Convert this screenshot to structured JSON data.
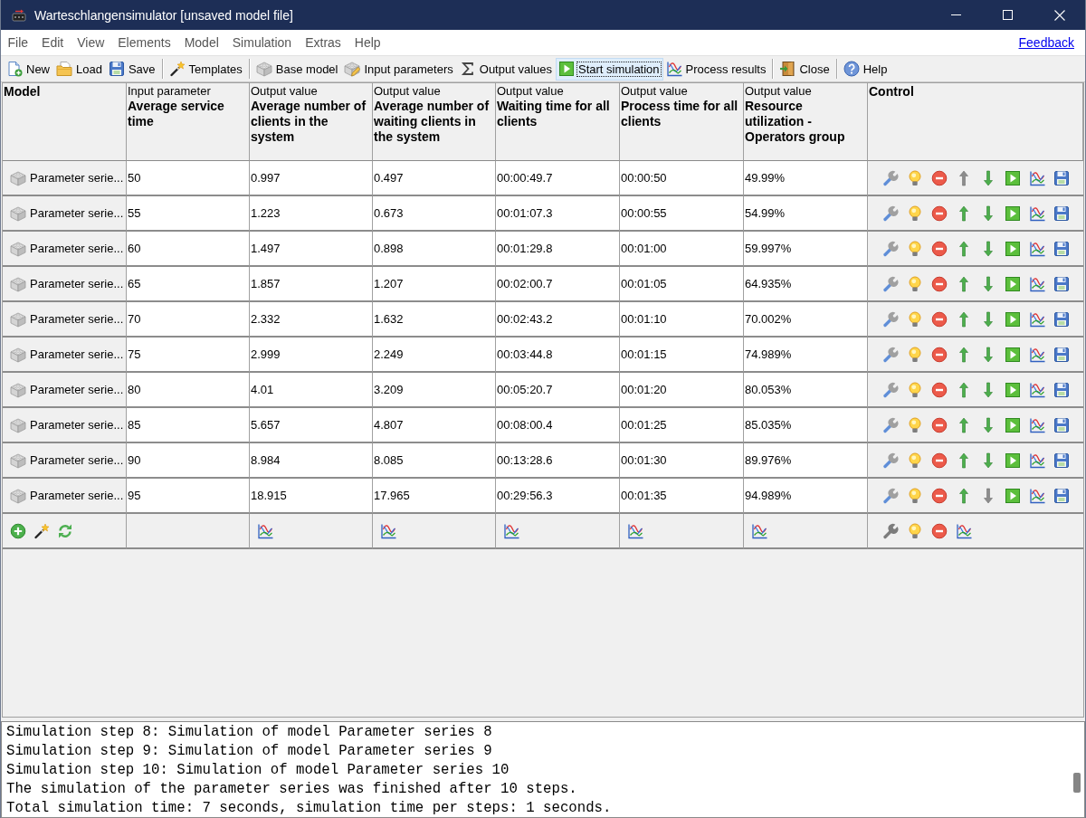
{
  "window": {
    "title": "Warteschlangensimulator [unsaved model file]"
  },
  "menu_bar": {
    "items": [
      "File",
      "Edit",
      "View",
      "Elements",
      "Model",
      "Simulation",
      "Extras",
      "Help"
    ],
    "link": "Feedback"
  },
  "toolbar": [
    {
      "kind": "new",
      "label": "New",
      "focused": false,
      "separator_after": false
    },
    {
      "kind": "load",
      "label": "Load",
      "focused": false,
      "separator_after": false
    },
    {
      "kind": "save",
      "label": "Save",
      "focused": false,
      "separator_after": true
    },
    {
      "kind": "templates",
      "label": "Templates",
      "focused": false,
      "separator_after": true
    },
    {
      "kind": "base",
      "label": "Base model",
      "focused": false,
      "separator_after": false
    },
    {
      "kind": "input",
      "label": "Input parameters",
      "focused": false,
      "separator_after": false
    },
    {
      "kind": "output",
      "label": "Output values",
      "focused": false,
      "separator_after": false
    },
    {
      "kind": "start",
      "label": "Start simulation",
      "focused": true,
      "separator_after": false
    },
    {
      "kind": "results",
      "label": "Process results",
      "focused": false,
      "separator_after": true
    },
    {
      "kind": "close",
      "label": "Close",
      "focused": false,
      "separator_after": true
    },
    {
      "kind": "help",
      "label": "Help",
      "focused": false,
      "separator_after": false
    }
  ],
  "table": {
    "columns": [
      {
        "kind": "model",
        "title": "Model"
      },
      {
        "kind": "input",
        "caption": "Input parameter",
        "title": "Average service time"
      },
      {
        "kind": "output",
        "caption": "Output value",
        "title": "Average number of clients in the system"
      },
      {
        "kind": "output",
        "caption": "Output value",
        "title": "Average number of waiting clients in the system"
      },
      {
        "kind": "output",
        "caption": "Output value",
        "title": "Waiting time for all clients"
      },
      {
        "kind": "output",
        "caption": "Output value",
        "title": "Process time for all clients"
      },
      {
        "kind": "output",
        "caption": "Output value",
        "title": "Resource utilization - Operators group"
      },
      {
        "kind": "control",
        "title": "Control"
      }
    ],
    "rows": [
      {
        "model": "Parameter serie...",
        "values": [
          "50",
          "0.997",
          "0.497",
          "00:00:49.7",
          "00:00:50",
          "49.99%"
        ],
        "can_move_up": false,
        "can_move_down": true
      },
      {
        "model": "Parameter serie...",
        "values": [
          "55",
          "1.223",
          "0.673",
          "00:01:07.3",
          "00:00:55",
          "54.99%"
        ],
        "can_move_up": true,
        "can_move_down": true
      },
      {
        "model": "Parameter serie...",
        "values": [
          "60",
          "1.497",
          "0.898",
          "00:01:29.8",
          "00:01:00",
          "59.997%"
        ],
        "can_move_up": true,
        "can_move_down": true
      },
      {
        "model": "Parameter serie...",
        "values": [
          "65",
          "1.857",
          "1.207",
          "00:02:00.7",
          "00:01:05",
          "64.935%"
        ],
        "can_move_up": true,
        "can_move_down": true
      },
      {
        "model": "Parameter serie...",
        "values": [
          "70",
          "2.332",
          "1.632",
          "00:02:43.2",
          "00:01:10",
          "70.002%"
        ],
        "can_move_up": true,
        "can_move_down": true
      },
      {
        "model": "Parameter serie...",
        "values": [
          "75",
          "2.999",
          "2.249",
          "00:03:44.8",
          "00:01:15",
          "74.989%"
        ],
        "can_move_up": true,
        "can_move_down": true
      },
      {
        "model": "Parameter serie...",
        "values": [
          "80",
          "4.01",
          "3.209",
          "00:05:20.7",
          "00:01:20",
          "80.053%"
        ],
        "can_move_up": true,
        "can_move_down": true
      },
      {
        "model": "Parameter serie...",
        "values": [
          "85",
          "5.657",
          "4.807",
          "00:08:00.4",
          "00:01:25",
          "85.035%"
        ],
        "can_move_up": true,
        "can_move_down": true
      },
      {
        "model": "Parameter serie...",
        "values": [
          "90",
          "8.984",
          "8.085",
          "00:13:28.6",
          "00:01:30",
          "89.976%"
        ],
        "can_move_up": true,
        "can_move_down": true
      },
      {
        "model": "Parameter serie...",
        "values": [
          "95",
          "18.915",
          "17.965",
          "00:29:56.3",
          "00:01:35",
          "94.989%"
        ],
        "can_move_up": true,
        "can_move_down": false
      }
    ],
    "footer": {
      "edit_enabled": false
    }
  },
  "log": {
    "lines": [
      "Simulation step 8: Simulation of model Parameter series 8",
      "Simulation step 9: Simulation of model Parameter series 9",
      "Simulation step 10: Simulation of model Parameter series 10",
      "The simulation of the parameter series was finished after 10 steps.",
      "Total simulation time: 7 seconds, simulation time per steps: 1 seconds."
    ]
  }
}
